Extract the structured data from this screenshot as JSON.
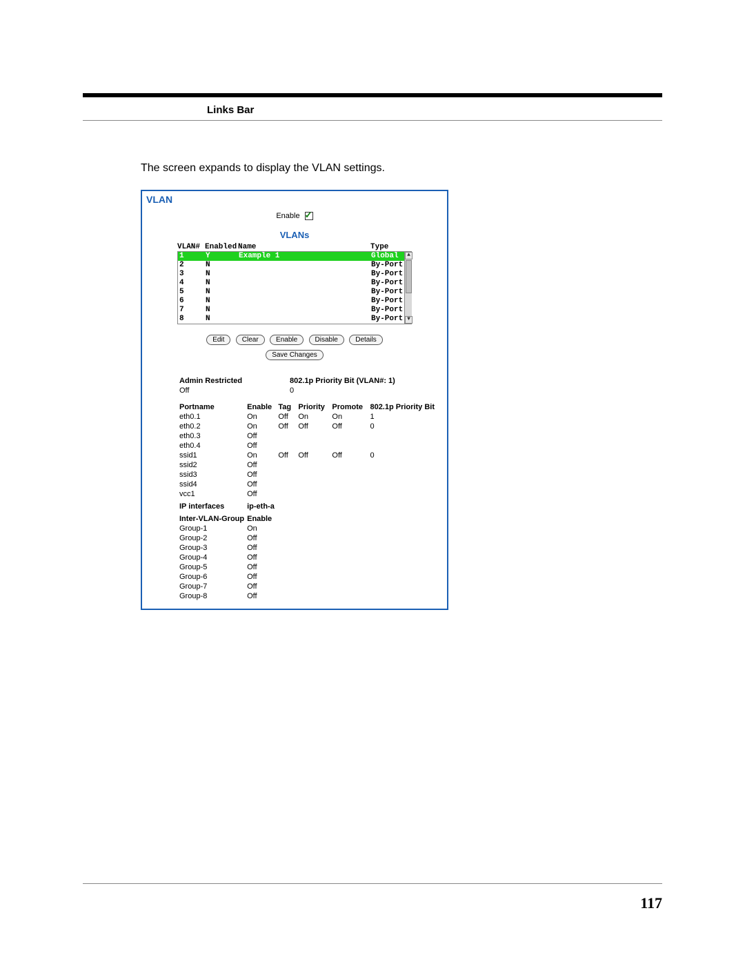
{
  "header_links_label": "Links Bar",
  "intro_text": "The screen expands to display the VLAN settings.",
  "page_number": "117",
  "panel": {
    "title": "VLAN",
    "enable_label": "Enable",
    "enable_checked": true,
    "subhead": "VLANs",
    "columns": {
      "c1": "VLAN#",
      "c2": "Enabled",
      "c3": "Name",
      "c4": "Type"
    },
    "rows": [
      {
        "n": "1",
        "en": "Y",
        "name": "Example 1",
        "type": "Global",
        "selected": true
      },
      {
        "n": "2",
        "en": "N",
        "name": "",
        "type": "By-Port"
      },
      {
        "n": "3",
        "en": "N",
        "name": "",
        "type": "By-Port"
      },
      {
        "n": "4",
        "en": "N",
        "name": "",
        "type": "By-Port"
      },
      {
        "n": "5",
        "en": "N",
        "name": "",
        "type": "By-Port"
      },
      {
        "n": "6",
        "en": "N",
        "name": "",
        "type": "By-Port"
      },
      {
        "n": "7",
        "en": "N",
        "name": "",
        "type": "By-Port"
      },
      {
        "n": "8",
        "en": "N",
        "name": "",
        "type": "By-Port"
      }
    ],
    "buttons_row1": {
      "edit": "Edit",
      "clear": "Clear",
      "enable": "Enable",
      "disable": "Disable",
      "details": "Details"
    },
    "buttons_row2": {
      "save": "Save Changes"
    },
    "admin_label": "Admin Restricted",
    "admin_value": "Off",
    "prio_label": "802.1p Priority Bit (VLAN#: 1)",
    "prio_value": "0",
    "port_head": {
      "name": "Portname",
      "enable": "Enable",
      "tag": "Tag",
      "priority": "Priority",
      "promote": "Promote",
      "pbit": "802.1p Priority Bit"
    },
    "ports": [
      {
        "name": "eth0.1",
        "en": "On",
        "tag": "Off",
        "pr": "On",
        "pm": "On",
        "pb": "1"
      },
      {
        "name": "eth0.2",
        "en": "On",
        "tag": "Off",
        "pr": "Off",
        "pm": "Off",
        "pb": "0"
      },
      {
        "name": "eth0.3",
        "en": "Off",
        "tag": "",
        "pr": "",
        "pm": "",
        "pb": ""
      },
      {
        "name": "eth0.4",
        "en": "Off",
        "tag": "",
        "pr": "",
        "pm": "",
        "pb": ""
      },
      {
        "name": "ssid1",
        "en": "On",
        "tag": "Off",
        "pr": "Off",
        "pm": "Off",
        "pb": "0"
      },
      {
        "name": "ssid2",
        "en": "Off",
        "tag": "",
        "pr": "",
        "pm": "",
        "pb": ""
      },
      {
        "name": "ssid3",
        "en": "Off",
        "tag": "",
        "pr": "",
        "pm": "",
        "pb": ""
      },
      {
        "name": "ssid4",
        "en": "Off",
        "tag": "",
        "pr": "",
        "pm": "",
        "pb": ""
      },
      {
        "name": "vcc1",
        "en": "Off",
        "tag": "",
        "pr": "",
        "pm": "",
        "pb": ""
      }
    ],
    "ip_if_label": "IP interfaces",
    "ip_if_value": "ip-eth-a",
    "group_head": {
      "name": "Inter-VLAN-Group",
      "enable": "Enable"
    },
    "groups": [
      {
        "name": "Group-1",
        "en": "On"
      },
      {
        "name": "Group-2",
        "en": "Off"
      },
      {
        "name": "Group-3",
        "en": "Off"
      },
      {
        "name": "Group-4",
        "en": "Off"
      },
      {
        "name": "Group-5",
        "en": "Off"
      },
      {
        "name": "Group-6",
        "en": "Off"
      },
      {
        "name": "Group-7",
        "en": "Off"
      },
      {
        "name": "Group-8",
        "en": "Off"
      }
    ]
  }
}
